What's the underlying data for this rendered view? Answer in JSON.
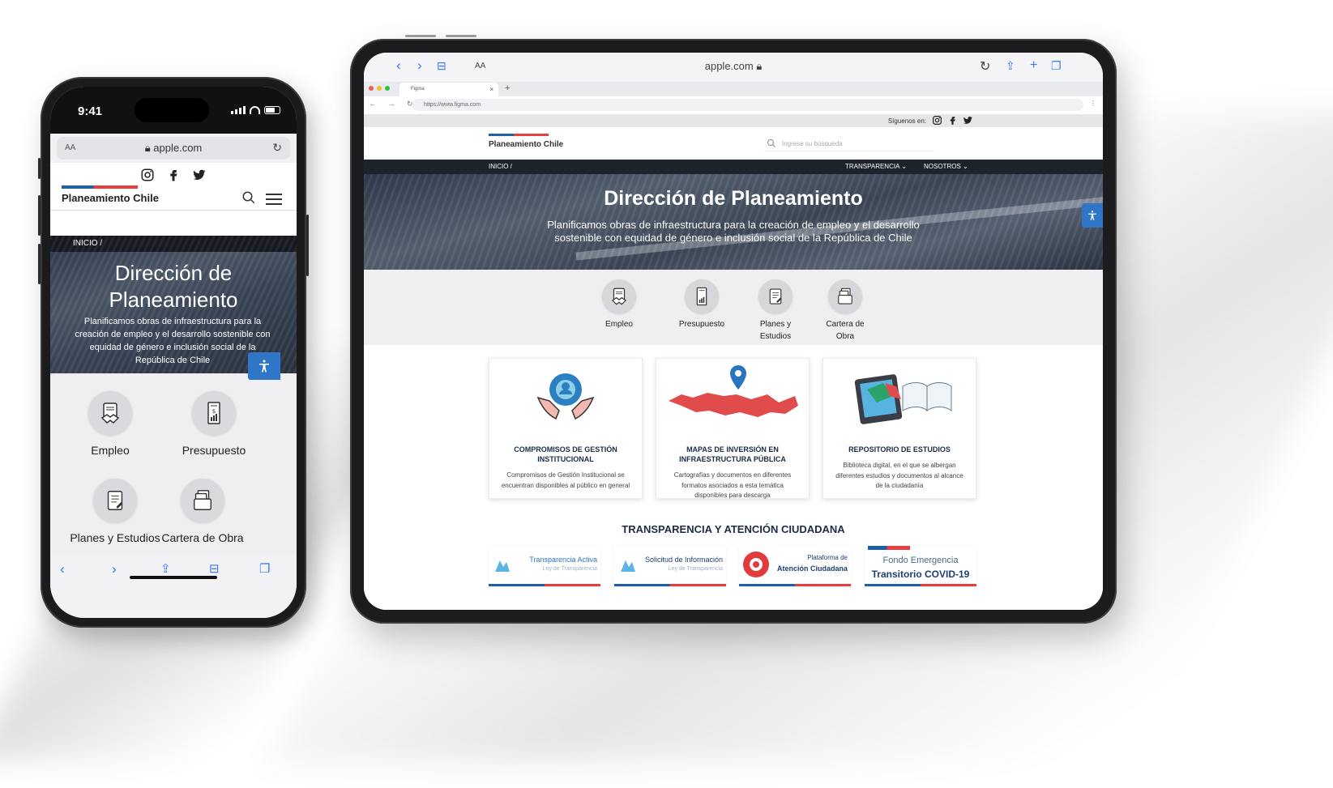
{
  "phone": {
    "status_time": "9:41",
    "url_aa": "AA",
    "url_host": "apple.com",
    "brand": "Planeamiento Chile",
    "breadcrumb": "INICIO /",
    "hero_title": "Dirección de Planeamiento",
    "hero_subtitle": "Planificamos obras de infraestructura para la creación de empleo y el desarrollo sostenible con equidad de género e inclusión social de la República de Chile",
    "tiles": [
      {
        "label": "Empleo",
        "icon": "handshake-icon"
      },
      {
        "label": "Presupuesto",
        "icon": "budget-icon"
      },
      {
        "label": "Planes y Estudios",
        "icon": "document-list-icon"
      },
      {
        "label": "Cartera de Obra",
        "icon": "portfolio-icon"
      }
    ],
    "toolbar": [
      "back-icon",
      "forward-icon",
      "share-icon",
      "bookmarks-icon",
      "tabs-icon"
    ]
  },
  "tablet": {
    "url_aa": "AA",
    "url_host": "apple.com",
    "chrome_tab_label": "Figma",
    "chrome_url": "https://www.figma.com",
    "follow_label": "Síguenos en:",
    "brand": "Planeamiento Chile",
    "search_placeholder": "Ingrese su búsqueda",
    "breadcrumb": "INICIO /",
    "menu": [
      "TRANSPARENCIA",
      "NOSOTROS"
    ],
    "hero_title": "Dirección de Planeamiento",
    "hero_subtitle": "Planificamos obras de infraestructura para la creación de empleo y el desarrollo sostenible con equidad de género e inclusión social de la República de Chile",
    "quick_links": [
      {
        "label": "Empleo",
        "icon": "handshake-icon"
      },
      {
        "label": "Presupuesto",
        "icon": "budget-icon"
      },
      {
        "label": "Planes y Estudios",
        "icon": "document-list-icon"
      },
      {
        "label": "Cartera de Obra",
        "icon": "portfolio-icon"
      }
    ],
    "cards": [
      {
        "title": "COMPROMISOS DE GESTIÓN INSTITUCIONAL",
        "desc": "Compromisos de Gestión Institucional  se encuentran disponibles al público en general"
      },
      {
        "title": "MAPAS DE INVERSIÓN EN INFRAESTRUCTURA PÚBLICA",
        "desc": "Cartografías y documentos en diferentes formatos asociados a esta temática disponibles para descarga"
      },
      {
        "title": "REPOSITORIO DE ESTUDIOS",
        "desc": "Biblioteca digital, en el que se albergan diferentes estudios y documentos al alcance de la ciudadanía"
      }
    ],
    "transparency_title": "TRANSPARENCIA Y ATENCIÓN CIUDADANA",
    "logos": [
      {
        "line1": "Transparencia Activa",
        "line2": "Ley de Transparencia"
      },
      {
        "line1": "Solicitud de Información",
        "line2": "Ley de Transparencia"
      },
      {
        "line1": "Plataforma de",
        "line2": "Atención Ciudadana"
      },
      {
        "line1": "Fondo Emergencia",
        "line2": "Transitorio COVID-19"
      }
    ]
  },
  "colors": {
    "brand_blue": "#1f5ea8",
    "brand_red": "#e63f3f",
    "access_blue": "#2f76c8",
    "nav_dark": "#1e232b",
    "ios_blue": "#3478f6"
  }
}
